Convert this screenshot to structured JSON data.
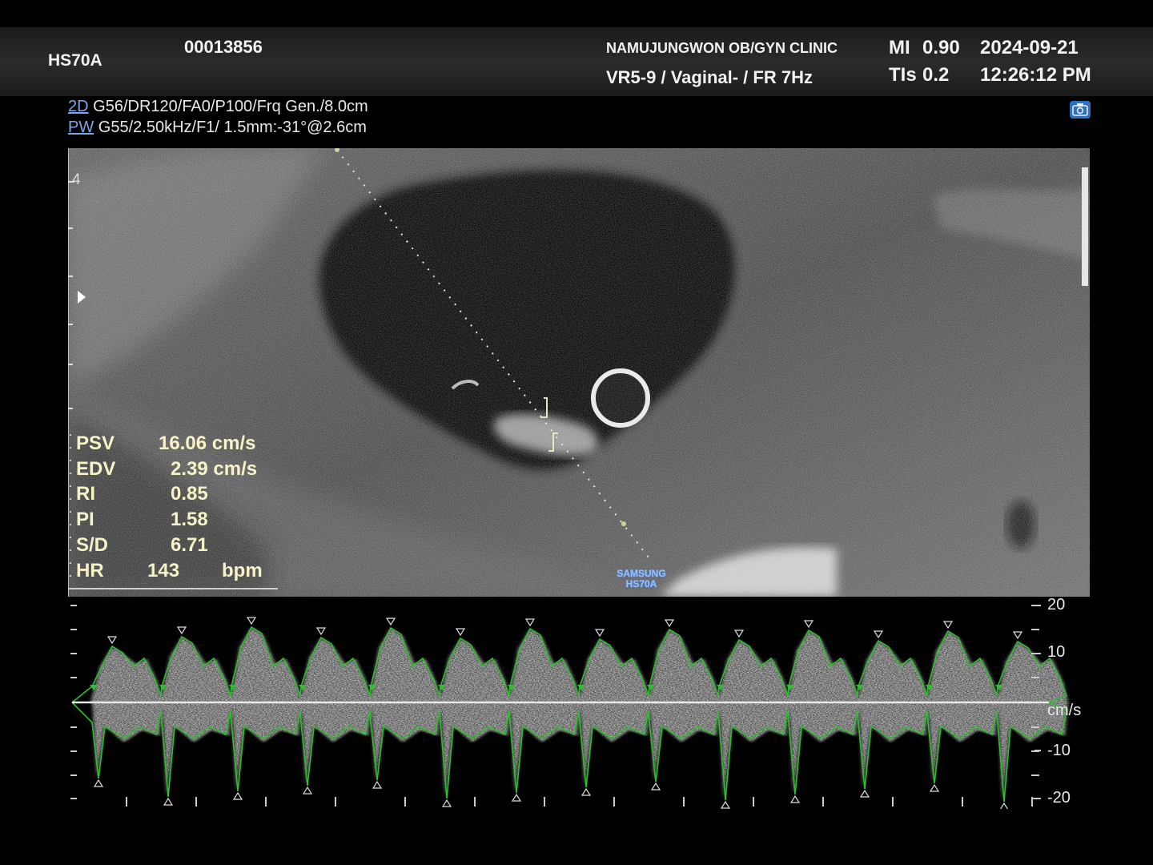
{
  "header": {
    "device": "HS70A",
    "patient_id": "00013856",
    "clinic": "NAMUJUNGWON OB/GYN CLINIC",
    "probe_info": "VR5-9 / Vaginal- / FR 7Hz",
    "mi_label": "MI",
    "mi_value": "0.90",
    "tis_label": "TIs",
    "tis_value": "0.2",
    "date": "2024-09-21",
    "time": "12:26:12 PM"
  },
  "params": {
    "mode_2d": "2D",
    "line_2d": "G56/DR120/FA0/P100/Frq Gen./8.0cm",
    "mode_pw": "PW",
    "line_pw": "G55/2.50kHz/F1/ 1.5mm:-31°@2.6cm"
  },
  "depth_marker": "4",
  "measurements": [
    {
      "label": "PSV",
      "value": "16.06 cm/s"
    },
    {
      "label": "EDV",
      "value": "2.39 cm/s"
    },
    {
      "label": "RI",
      "value": "0.85"
    },
    {
      "label": "PI",
      "value": "1.58"
    },
    {
      "label": "S/D",
      "value": "6.71"
    },
    {
      "label": "HR",
      "value": "143",
      "unit": "bpm"
    }
  ],
  "brand": {
    "line1": "SAMSUNG",
    "line2": "HS70A"
  },
  "doppler": {
    "unit": "cm/s",
    "scale_labels": [
      "20",
      "10",
      "-10",
      "-20"
    ],
    "trace_color": "#2fbf2f"
  },
  "icons": {
    "camera": "camera-icon"
  }
}
